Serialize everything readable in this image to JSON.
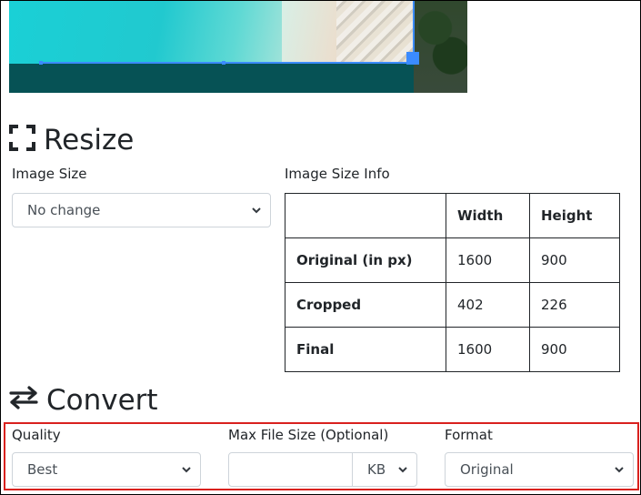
{
  "resize": {
    "title": "Resize",
    "image_size_label": "Image Size",
    "image_size_value": "No change",
    "info_label": "Image Size Info",
    "info_table": {
      "headers": [
        "",
        "Width",
        "Height"
      ],
      "rows": [
        [
          "Original (in px)",
          "1600",
          "900"
        ],
        [
          "Cropped",
          "402",
          "226"
        ],
        [
          "Final",
          "1600",
          "900"
        ]
      ]
    }
  },
  "convert": {
    "title": "Convert",
    "quality_label": "Quality",
    "quality_value": "Best",
    "max_size_label": "Max File Size (Optional)",
    "max_size_value": "",
    "unit_value": "KB",
    "format_label": "Format",
    "format_value": "Original"
  },
  "colors": {
    "crop_handle": "#3b8bff",
    "highlight_border": "#d9211e"
  },
  "icons": {
    "resize": "fullscreen-corners-icon",
    "convert": "swap-arrows-icon",
    "select": "chevron-down-icon"
  }
}
